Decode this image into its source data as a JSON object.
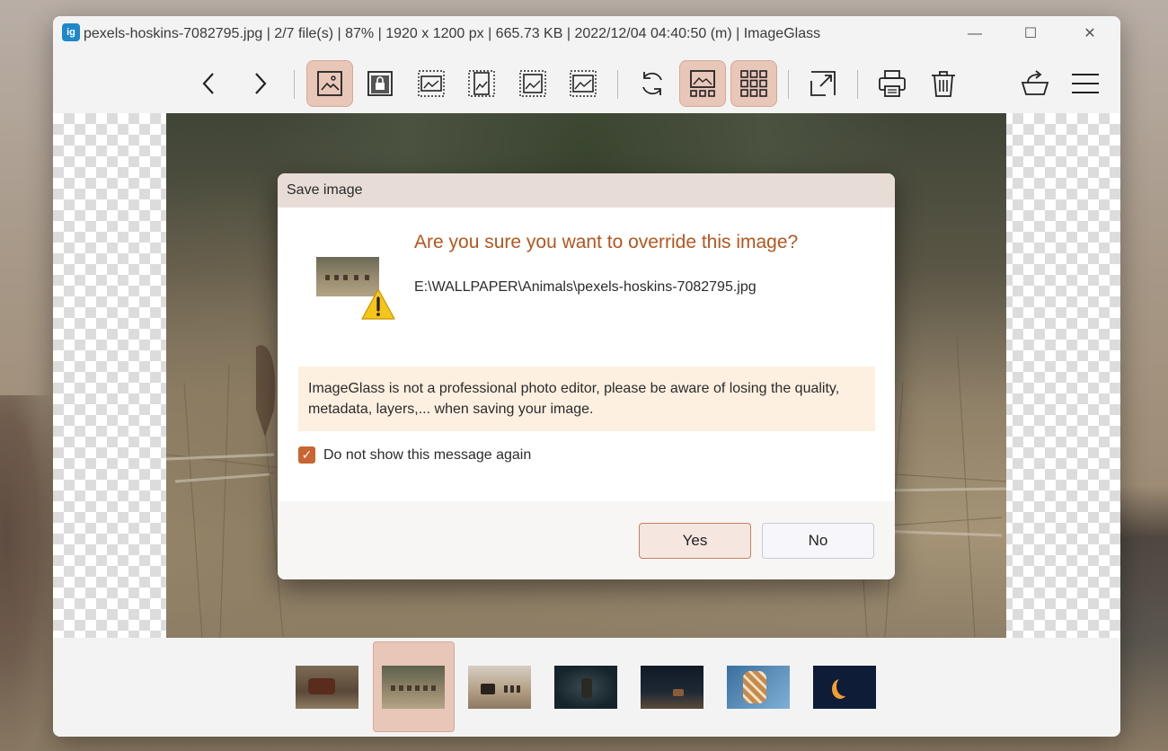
{
  "window": {
    "title": "pexels-hoskins-7082795.jpg  |  2/7 file(s)  |  87%  |  1920 x 1200 px  |  665.73 KB  |  2022/12/04 04:40:50 (m)  |  ImageGlass",
    "app_icon_text": "ig",
    "minimize_glyph": "—",
    "maximize_glyph": "☐",
    "close_glyph": "✕"
  },
  "toolbar": {
    "buttons": [
      {
        "icon": "chevron-left-icon"
      },
      {
        "icon": "chevron-right-icon"
      },
      {
        "icon": "auto-zoom-icon",
        "active": true
      },
      {
        "icon": "lock-zoom-icon"
      },
      {
        "icon": "scale-to-width-icon"
      },
      {
        "icon": "scale-to-height-icon"
      },
      {
        "icon": "scale-to-fit-icon"
      },
      {
        "icon": "scale-to-fill-icon"
      },
      {
        "icon": "refresh-icon"
      },
      {
        "icon": "gallery-icon",
        "active": true
      },
      {
        "icon": "grid-icon",
        "active": true
      },
      {
        "icon": "fullscreen-icon"
      },
      {
        "icon": "print-icon"
      },
      {
        "icon": "trash-icon"
      },
      {
        "icon": "export-icon"
      },
      {
        "icon": "menu-icon"
      }
    ]
  },
  "dialog": {
    "title": "Save image",
    "heading": "Are you sure you want to override this image?",
    "path": "E:\\WALLPAPER\\Animals\\pexels-hoskins-7082795.jpg",
    "note": "ImageGlass is not a professional photo editor, please be aware of losing the quality, metadata, layers,... when saving your image.",
    "checkbox_label": "Do not show this message again",
    "checkbox_checked": true,
    "checkmark": "✓",
    "yes_label": "Yes",
    "no_label": "No",
    "accent_color": "#b5551e"
  },
  "gallery": {
    "selected_index": 1,
    "count": 7
  }
}
